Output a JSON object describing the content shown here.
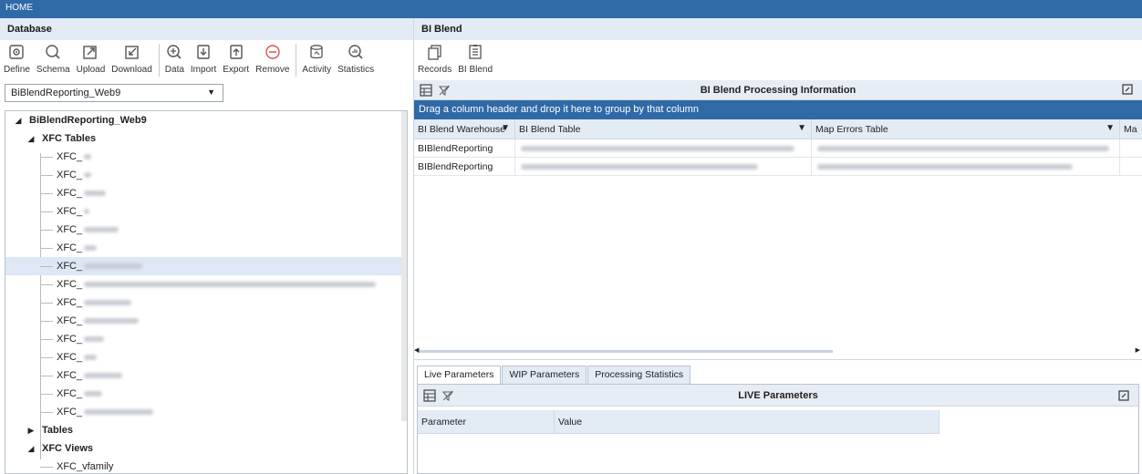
{
  "window": {
    "title": "HOME"
  },
  "database": {
    "header": "Database",
    "toolbar": [
      {
        "label": "Define",
        "icon": "define-icon"
      },
      {
        "label": "Schema",
        "icon": "schema-icon"
      },
      {
        "label": "Upload",
        "icon": "upload-icon"
      },
      {
        "label": "Download",
        "icon": "download-icon"
      },
      {
        "label": "Data",
        "icon": "data-icon"
      },
      {
        "label": "Import",
        "icon": "import-icon"
      },
      {
        "label": "Export",
        "icon": "export-icon"
      },
      {
        "label": "Remove",
        "icon": "remove-icon"
      },
      {
        "label": "Activity",
        "icon": "activity-icon"
      },
      {
        "label": "Statistics",
        "icon": "statistics-icon"
      }
    ],
    "selector": {
      "value": "BiBlendReporting_Web9"
    },
    "tree": {
      "root": "BiBlendReporting_Web9",
      "xfc_tables": "XFC Tables",
      "xfc_prefix": "XFC_",
      "tables": "Tables",
      "xfc_views": "XFC Views",
      "view_item": "XFC_vfamily"
    }
  },
  "biblend": {
    "header": "BI Blend",
    "toolbar": [
      {
        "label": "Records",
        "icon": "records-icon"
      },
      {
        "label": "BI Blend",
        "icon": "biblend-icon"
      }
    ],
    "processing": {
      "title": "BI Blend Processing Information",
      "group_hint": "Drag a column header and drop it here to group by that column",
      "columns": [
        "BI Blend Warehouse",
        "BI Blend Table",
        "Map Errors Table",
        "Ma"
      ],
      "rows": [
        {
          "warehouse": "BIBlendReporting"
        },
        {
          "warehouse": "BIBlendReporting"
        }
      ]
    },
    "tabs": [
      "Live Parameters",
      "WIP Parameters",
      "Processing Statistics"
    ],
    "live": {
      "title": "LIVE Parameters",
      "columns": [
        "Parameter",
        "Value"
      ]
    }
  },
  "colors": {
    "accent": "#2f6aa7",
    "header_bg": "#e3ebf5",
    "selection": "#dde7f5",
    "remove": "#d9534f"
  }
}
